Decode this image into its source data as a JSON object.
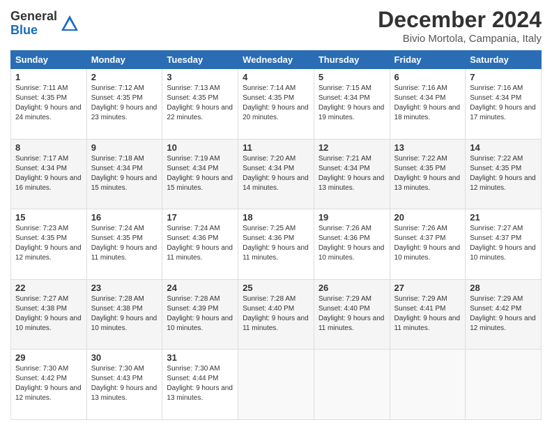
{
  "logo": {
    "general": "General",
    "blue": "Blue"
  },
  "title": "December 2024",
  "subtitle": "Bivio Mortola, Campania, Italy",
  "days_of_week": [
    "Sunday",
    "Monday",
    "Tuesday",
    "Wednesday",
    "Thursday",
    "Friday",
    "Saturday"
  ],
  "weeks": [
    [
      {
        "day": "1",
        "sunrise": "7:11 AM",
        "sunset": "4:35 PM",
        "daylight": "9 hours and 24 minutes."
      },
      {
        "day": "2",
        "sunrise": "7:12 AM",
        "sunset": "4:35 PM",
        "daylight": "9 hours and 23 minutes."
      },
      {
        "day": "3",
        "sunrise": "7:13 AM",
        "sunset": "4:35 PM",
        "daylight": "9 hours and 22 minutes."
      },
      {
        "day": "4",
        "sunrise": "7:14 AM",
        "sunset": "4:35 PM",
        "daylight": "9 hours and 20 minutes."
      },
      {
        "day": "5",
        "sunrise": "7:15 AM",
        "sunset": "4:34 PM",
        "daylight": "9 hours and 19 minutes."
      },
      {
        "day": "6",
        "sunrise": "7:16 AM",
        "sunset": "4:34 PM",
        "daylight": "9 hours and 18 minutes."
      },
      {
        "day": "7",
        "sunrise": "7:16 AM",
        "sunset": "4:34 PM",
        "daylight": "9 hours and 17 minutes."
      }
    ],
    [
      {
        "day": "8",
        "sunrise": "7:17 AM",
        "sunset": "4:34 PM",
        "daylight": "9 hours and 16 minutes."
      },
      {
        "day": "9",
        "sunrise": "7:18 AM",
        "sunset": "4:34 PM",
        "daylight": "9 hours and 15 minutes."
      },
      {
        "day": "10",
        "sunrise": "7:19 AM",
        "sunset": "4:34 PM",
        "daylight": "9 hours and 15 minutes."
      },
      {
        "day": "11",
        "sunrise": "7:20 AM",
        "sunset": "4:34 PM",
        "daylight": "9 hours and 14 minutes."
      },
      {
        "day": "12",
        "sunrise": "7:21 AM",
        "sunset": "4:34 PM",
        "daylight": "9 hours and 13 minutes."
      },
      {
        "day": "13",
        "sunrise": "7:22 AM",
        "sunset": "4:35 PM",
        "daylight": "9 hours and 13 minutes."
      },
      {
        "day": "14",
        "sunrise": "7:22 AM",
        "sunset": "4:35 PM",
        "daylight": "9 hours and 12 minutes."
      }
    ],
    [
      {
        "day": "15",
        "sunrise": "7:23 AM",
        "sunset": "4:35 PM",
        "daylight": "9 hours and 12 minutes."
      },
      {
        "day": "16",
        "sunrise": "7:24 AM",
        "sunset": "4:35 PM",
        "daylight": "9 hours and 11 minutes."
      },
      {
        "day": "17",
        "sunrise": "7:24 AM",
        "sunset": "4:36 PM",
        "daylight": "9 hours and 11 minutes."
      },
      {
        "day": "18",
        "sunrise": "7:25 AM",
        "sunset": "4:36 PM",
        "daylight": "9 hours and 11 minutes."
      },
      {
        "day": "19",
        "sunrise": "7:26 AM",
        "sunset": "4:36 PM",
        "daylight": "9 hours and 10 minutes."
      },
      {
        "day": "20",
        "sunrise": "7:26 AM",
        "sunset": "4:37 PM",
        "daylight": "9 hours and 10 minutes."
      },
      {
        "day": "21",
        "sunrise": "7:27 AM",
        "sunset": "4:37 PM",
        "daylight": "9 hours and 10 minutes."
      }
    ],
    [
      {
        "day": "22",
        "sunrise": "7:27 AM",
        "sunset": "4:38 PM",
        "daylight": "9 hours and 10 minutes."
      },
      {
        "day": "23",
        "sunrise": "7:28 AM",
        "sunset": "4:38 PM",
        "daylight": "9 hours and 10 minutes."
      },
      {
        "day": "24",
        "sunrise": "7:28 AM",
        "sunset": "4:39 PM",
        "daylight": "9 hours and 10 minutes."
      },
      {
        "day": "25",
        "sunrise": "7:28 AM",
        "sunset": "4:40 PM",
        "daylight": "9 hours and 11 minutes."
      },
      {
        "day": "26",
        "sunrise": "7:29 AM",
        "sunset": "4:40 PM",
        "daylight": "9 hours and 11 minutes."
      },
      {
        "day": "27",
        "sunrise": "7:29 AM",
        "sunset": "4:41 PM",
        "daylight": "9 hours and 11 minutes."
      },
      {
        "day": "28",
        "sunrise": "7:29 AM",
        "sunset": "4:42 PM",
        "daylight": "9 hours and 12 minutes."
      }
    ],
    [
      {
        "day": "29",
        "sunrise": "7:30 AM",
        "sunset": "4:42 PM",
        "daylight": "9 hours and 12 minutes."
      },
      {
        "day": "30",
        "sunrise": "7:30 AM",
        "sunset": "4:43 PM",
        "daylight": "9 hours and 13 minutes."
      },
      {
        "day": "31",
        "sunrise": "7:30 AM",
        "sunset": "4:44 PM",
        "daylight": "9 hours and 13 minutes."
      },
      null,
      null,
      null,
      null
    ]
  ]
}
